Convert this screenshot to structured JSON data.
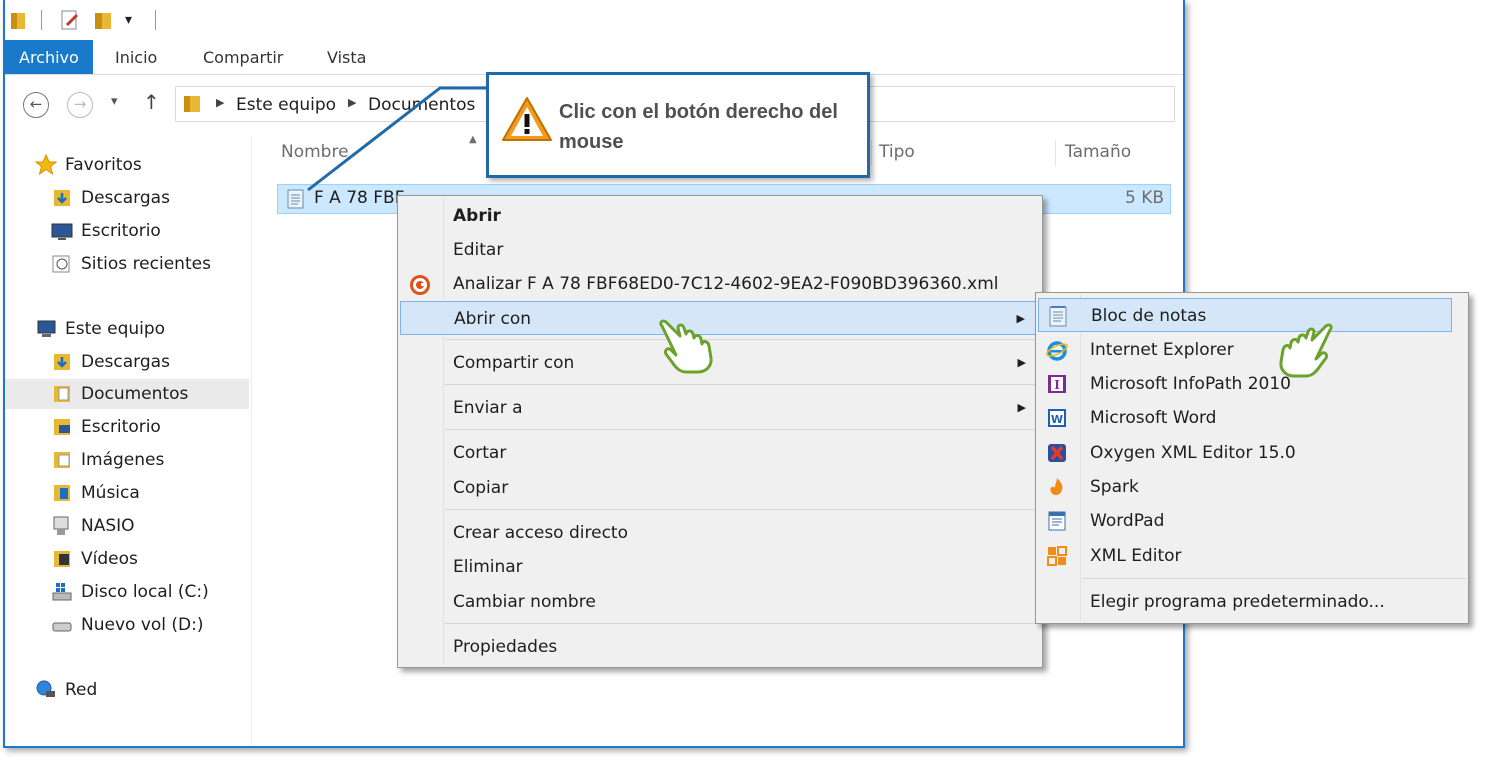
{
  "ribbon": {
    "tabs": [
      {
        "label": "Archivo"
      },
      {
        "label": "Inicio"
      },
      {
        "label": "Compartir"
      },
      {
        "label": "Vista"
      }
    ]
  },
  "address": {
    "crumbs": [
      "Este equipo",
      "Documentos"
    ]
  },
  "nav": {
    "favorites_label": "Favoritos",
    "favorites": [
      "Descargas",
      "Escritorio",
      "Sitios recientes"
    ],
    "pc_label": "Este equipo",
    "pc_items": [
      "Descargas",
      "Documentos",
      "Escritorio",
      "Imágenes",
      "Música",
      "NASIO",
      "Vídeos",
      "Disco local (C:)",
      "Nuevo vol (D:)"
    ],
    "network_label": "Red"
  },
  "columns": {
    "name": "Nombre",
    "type": "Tipo",
    "size": "Tamaño"
  },
  "file": {
    "name": "F A 78 FBF",
    "size": "5 KB"
  },
  "callout": {
    "text": "Clic con el botón derecho del mouse"
  },
  "context_menu": {
    "open": "Abrir",
    "edit": "Editar",
    "analyze": "Analizar F A 78 FBF68ED0-7C12-4602-9EA2-F090BD396360.xml",
    "open_with": "Abrir con",
    "share_with": "Compartir con",
    "send_to": "Enviar a",
    "cut": "Cortar",
    "copy": "Copiar",
    "create_shortcut": "Crear acceso directo",
    "delete": "Eliminar",
    "rename": "Cambiar nombre",
    "properties": "Propiedades"
  },
  "open_with_menu": {
    "items": [
      {
        "label": "Bloc de notas",
        "icon": "notepad-icon"
      },
      {
        "label": "Internet Explorer",
        "icon": "ie-icon"
      },
      {
        "label": "Microsoft InfoPath 2010",
        "icon": "infopath-icon"
      },
      {
        "label": "Microsoft Word",
        "icon": "word-icon"
      },
      {
        "label": "Oxygen XML Editor 15.0",
        "icon": "oxygen-icon"
      },
      {
        "label": "Spark",
        "icon": "spark-icon"
      },
      {
        "label": "WordPad",
        "icon": "wordpad-icon"
      },
      {
        "label": "XML Editor",
        "icon": "xml-editor-icon"
      }
    ],
    "choose_default": "Elegir programa predeterminado..."
  },
  "colors": {
    "accent": "#1979ca",
    "menu_hover": "#d5e6f8",
    "selection": "#cce8ff",
    "callout_border": "#1f6aa8"
  }
}
